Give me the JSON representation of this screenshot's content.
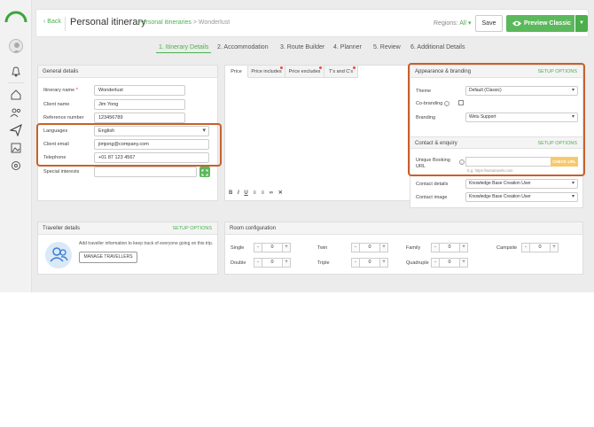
{
  "header": {
    "back_label": "Back",
    "page_title": "Personal itinerary",
    "breadcrumb_parent": "Personal itineraries",
    "breadcrumb_sep": ">",
    "breadcrumb_current": "Wonderlust",
    "regions_label": "Regions:",
    "regions_value": "All",
    "save_label": "Save",
    "preview_label": "Preview Classic"
  },
  "steps": [
    {
      "label": "1. Itinerary Details"
    },
    {
      "label": "2. Accommodation"
    },
    {
      "label": "3. Route Builder"
    },
    {
      "label": "4. Planner"
    },
    {
      "label": "5. Review"
    },
    {
      "label": "6. Additional Details"
    }
  ],
  "general": {
    "title": "General details",
    "itinerary_name_label": "Itinerary name",
    "itinerary_name_value": "Wonderlust",
    "client_name_label": "Client name",
    "client_name_value": "Jim Yong",
    "reference_label": "Reference number",
    "reference_value": "123456789",
    "languages_label": "Languages",
    "languages_value": "English",
    "client_email_label": "Client email",
    "client_email_value": "jimjong@company.com",
    "telephone_label": "Telephone",
    "telephone_value": "+01 87 123 4567",
    "special_interests_label": "Special interests",
    "required_mark": "*"
  },
  "price_panel": {
    "tabs": [
      {
        "label": "Price"
      },
      {
        "label": "Price includes"
      },
      {
        "label": "Price excludes"
      },
      {
        "label": "T's and C's"
      }
    ],
    "toolbar": {
      "bold": "B",
      "italic": "I",
      "underline": "U"
    }
  },
  "appearance": {
    "title": "Appearance & branding",
    "setup": "SETUP OPTIONS",
    "theme_label": "Theme",
    "theme_value": "Default (Classic)",
    "cobranding_label": "Co-branding",
    "branding_label": "Branding",
    "branding_value": "Wetu Support"
  },
  "contact": {
    "title": "Contact & enquiry",
    "setup": "SETUP OPTIONS",
    "booking_url_label_1": "Unique Booking",
    "booking_url_label_2": "URL",
    "booking_url_placeholder": "",
    "booking_url_hint": "E.g. https://wetutravels.com",
    "check_url_label": "CHECK URL",
    "contact_details_label": "Contact details",
    "contact_details_value": "Knowledge Base Creation User",
    "contact_image_label": "Contact image",
    "contact_image_value": "Knowledge Base Creation User"
  },
  "traveller": {
    "title": "Traveller details",
    "setup": "SETUP OPTIONS",
    "description": "Add traveller information to keep track of everyone going on this trip.",
    "manage_label": "MANAGE TRAVELLERS"
  },
  "rooms": {
    "title": "Room configuration",
    "items": [
      {
        "label": "Single",
        "value": "0"
      },
      {
        "label": "Twin",
        "value": "0"
      },
      {
        "label": "Family",
        "value": "0"
      },
      {
        "label": "Campsite",
        "value": "0"
      },
      {
        "label": "Double",
        "value": "0"
      },
      {
        "label": "Triple",
        "value": "0"
      },
      {
        "label": "Quadruple",
        "value": "0"
      }
    ],
    "minus": "-",
    "plus": "+"
  },
  "colors": {
    "accent": "#4caf50",
    "highlight": "#c8602a"
  }
}
